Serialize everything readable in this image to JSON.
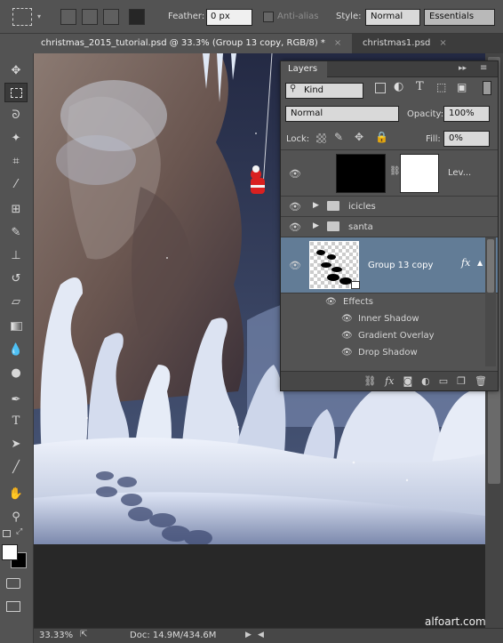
{
  "options_bar": {
    "feather_label": "Feather:",
    "feather_value": "0 px",
    "antialias_label": "Anti-alias",
    "style_label": "Style:",
    "style_value": "Normal",
    "workspace": "Essentials"
  },
  "tabs": [
    {
      "label": "christmas_2015_tutorial.psd @ 33.3% (Group 13 copy, RGB/8) *",
      "close": "×"
    },
    {
      "label": "christmas1.psd",
      "close": "×"
    }
  ],
  "layers_panel": {
    "title": "Layers",
    "filter_kind": "Kind",
    "blend_mode": "Normal",
    "opacity_label": "Opacity:",
    "opacity_value": "100%",
    "lock_label": "Lock:",
    "fill_label": "Fill:",
    "fill_value": "0%",
    "layers": [
      {
        "name": "Lev...",
        "type": "adjustment"
      },
      {
        "name": "icicles",
        "type": "group"
      },
      {
        "name": "santa",
        "type": "group"
      },
      {
        "name": "Group 13 copy",
        "type": "smart",
        "fx": "fx"
      }
    ],
    "effects_label": "Effects",
    "effects": [
      "Inner Shadow",
      "Gradient Overlay",
      "Drop Shadow"
    ]
  },
  "status": {
    "zoom": "33.33%",
    "doc": "Doc: 14.9M/434.6M"
  },
  "watermark": "alfoart.com",
  "colors": {
    "selected_layer": "#627c96",
    "panel_bg": "#535353",
    "canvas_sky": "#31394f"
  }
}
